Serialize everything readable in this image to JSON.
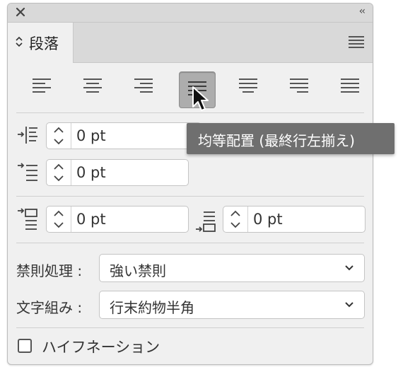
{
  "panel": {
    "collapse_glyph": "‹‹",
    "tab_label": "段落",
    "menu_icon": "hamburger-menu-icon"
  },
  "alignment": {
    "buttons": [
      {
        "name": "align-left",
        "active": false
      },
      {
        "name": "align-center",
        "active": false
      },
      {
        "name": "align-right",
        "active": false
      },
      {
        "name": "justify-last-left",
        "active": true
      },
      {
        "name": "justify-last-center",
        "active": false
      },
      {
        "name": "justify-last-right",
        "active": false
      },
      {
        "name": "justify-all",
        "active": false
      }
    ],
    "tooltip": "均等配置 (最終行左揃え)"
  },
  "indents": {
    "left_indent": "0 pt",
    "first_line_indent": "0 pt",
    "space_before": "0 pt",
    "space_after": "0 pt"
  },
  "kinsoku": {
    "label": "禁則処理 :",
    "value": "強い禁則"
  },
  "mojikumi": {
    "label": "文字組み :",
    "value": "行末約物半角"
  },
  "hyphenation": {
    "label": "ハイフネーション",
    "checked": false
  },
  "colors": {
    "panel_bg": "#f0f0f0",
    "titlebar_bg": "#d9d9d9",
    "active_button_bg": "#adadad",
    "tooltip_bg": "#6f6f6f"
  }
}
